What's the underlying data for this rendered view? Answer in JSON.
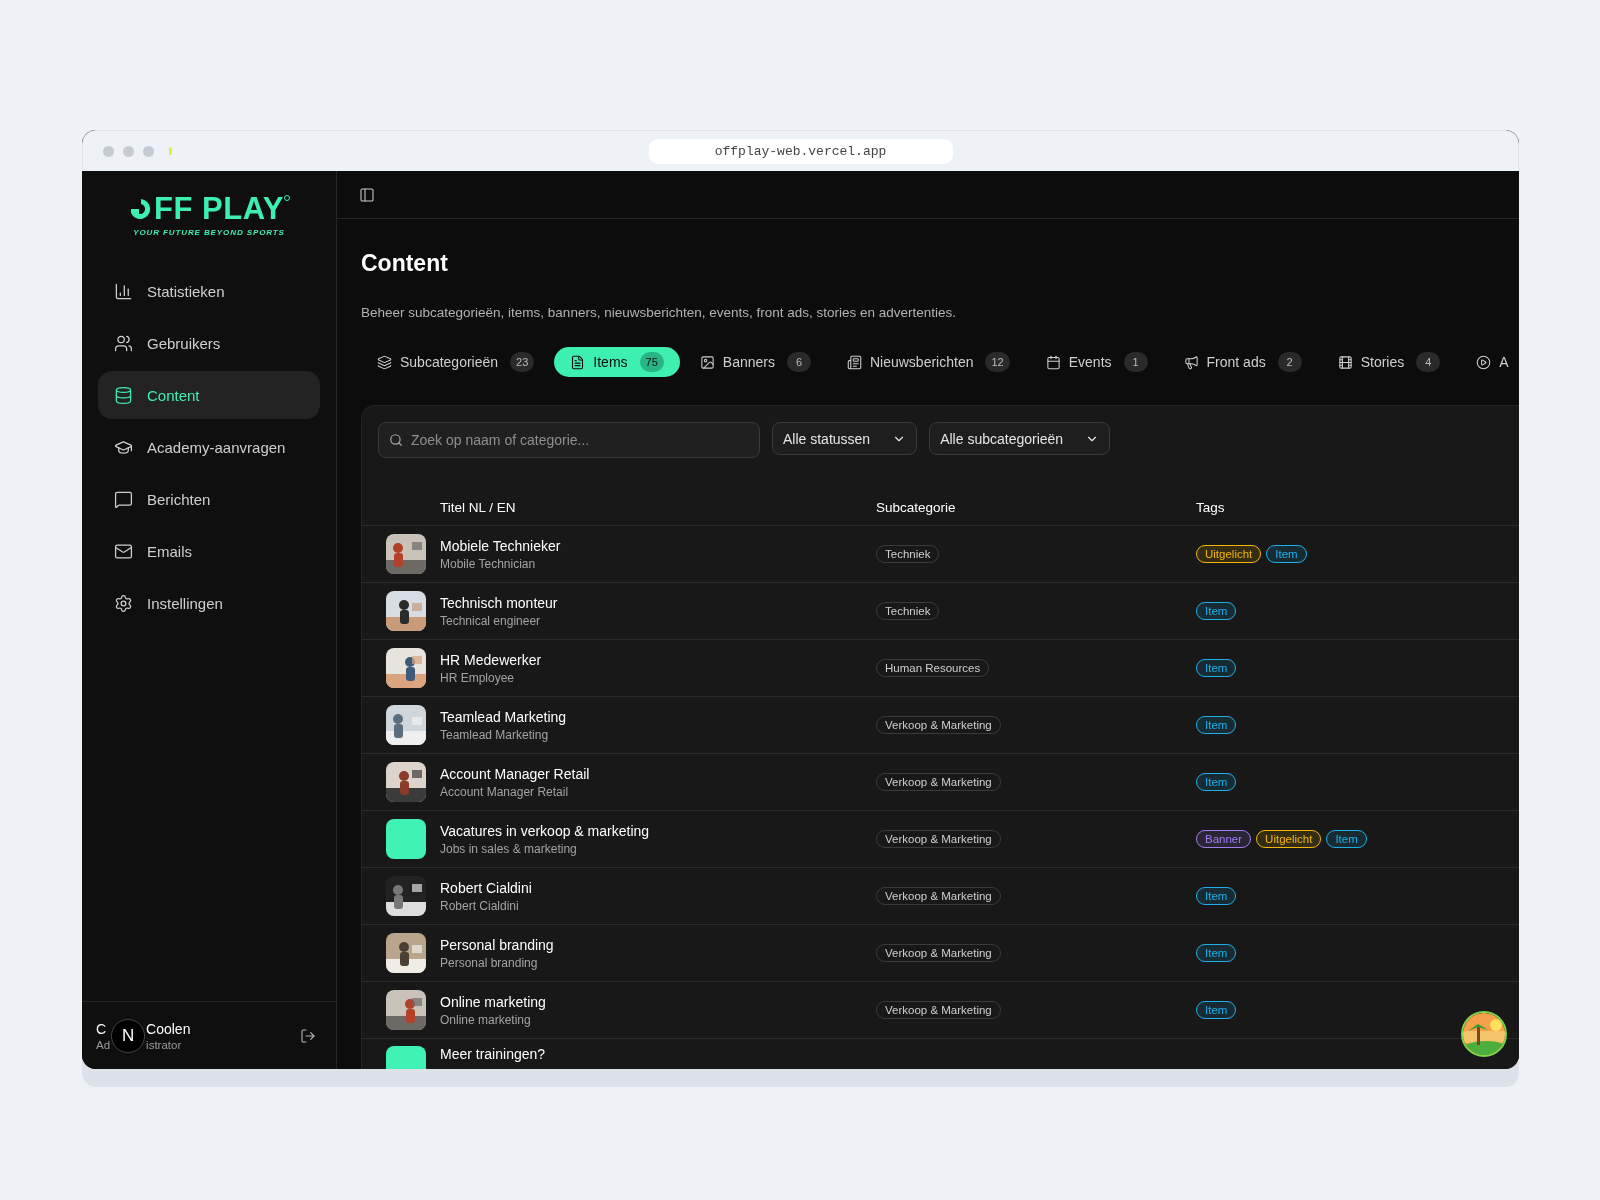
{
  "browser": {
    "url": "offplay-web.vercel.app"
  },
  "sidebar": {
    "logo": {
      "text": "FF PLAY",
      "tagline": "YOUR FUTURE BEYOND SPORTS"
    },
    "items": [
      {
        "label": "Statistieken",
        "selected": false
      },
      {
        "label": "Gebruikers",
        "selected": false
      },
      {
        "label": "Content",
        "selected": true
      },
      {
        "label": "Academy-aanvragen",
        "selected": false
      },
      {
        "label": "Berichten",
        "selected": false
      },
      {
        "label": "Emails",
        "selected": false
      },
      {
        "label": "Instellingen",
        "selected": false
      }
    ],
    "user": {
      "name_start": "C",
      "name_end": "Coolen",
      "role_start": "Ad",
      "role_end": "istrator",
      "badge": "N"
    }
  },
  "page": {
    "title": "Content",
    "description": "Beheer subcategorieën, items, banners, nieuwsberichten, events, front ads, stories en advertenties."
  },
  "tabs": [
    {
      "label": "Subcategorieën",
      "count": "23",
      "selected": false
    },
    {
      "label": "Items",
      "count": "75",
      "selected": true
    },
    {
      "label": "Banners",
      "count": "6",
      "selected": false
    },
    {
      "label": "Nieuwsberichten",
      "count": "12",
      "selected": false
    },
    {
      "label": "Events",
      "count": "1",
      "selected": false
    },
    {
      "label": "Front ads",
      "count": "2",
      "selected": false
    },
    {
      "label": "Stories",
      "count": "4",
      "selected": false
    },
    {
      "label": "A",
      "selected": false
    }
  ],
  "filters": {
    "search": {
      "placeholder": "Zoek op naam of categorie..."
    },
    "selects": [
      "Alle statussen",
      "Alle subcategorieën"
    ]
  },
  "table": {
    "columns": [
      "Titel NL / EN",
      "Subcategorie",
      "Tags"
    ],
    "rows": [
      {
        "title": "Mobiele Technieker",
        "subtitle": "Mobile Technician",
        "thumb": {
          "kind": "picture"
        },
        "subcategory": "Techniek",
        "tags": [
          {
            "label": "Uitgelicht",
            "color": "#f2b705"
          },
          {
            "label": "Item",
            "color": "#1cb0ea"
          }
        ]
      },
      {
        "title": "Technisch monteur",
        "subtitle": "Technical engineer",
        "thumb": {
          "kind": "picture"
        },
        "subcategory": "Techniek",
        "tags": [
          {
            "label": "Item",
            "color": "#1cb0ea"
          }
        ]
      },
      {
        "title": "HR Medewerker",
        "subtitle": "HR Employee",
        "thumb": {
          "kind": "picture"
        },
        "subcategory": "Human Resources",
        "tags": [
          {
            "label": "Item",
            "color": "#1cb0ea"
          }
        ]
      },
      {
        "title": "Teamlead Marketing",
        "subtitle": "Teamlead Marketing",
        "thumb": {
          "kind": "picture"
        },
        "subcategory": "Verkoop & Marketing",
        "tags": [
          {
            "label": "Item",
            "color": "#1cb0ea"
          }
        ]
      },
      {
        "title": "Account Manager Retail",
        "subtitle": "Account Manager Retail",
        "thumb": {
          "kind": "picture"
        },
        "subcategory": "Verkoop & Marketing",
        "tags": [
          {
            "label": "Item",
            "color": "#1cb0ea"
          }
        ]
      },
      {
        "title": "Vacatures in verkoop & marketing",
        "subtitle": "Jobs in sales & marketing",
        "thumb": {
          "kind": "swatch",
          "color": "#40f2b4"
        },
        "subcategory": "Verkoop & Marketing",
        "tags": [
          {
            "label": "Banner",
            "color": "#a27cf2"
          },
          {
            "label": "Uitgelicht",
            "color": "#f2b705"
          },
          {
            "label": "Item",
            "color": "#1cb0ea"
          }
        ]
      },
      {
        "title": "Robert Cialdini",
        "subtitle": "Robert Cialdini",
        "thumb": {
          "kind": "picture"
        },
        "subcategory": "Verkoop & Marketing",
        "tags": [
          {
            "label": "Item",
            "color": "#1cb0ea"
          }
        ]
      },
      {
        "title": "Personal branding",
        "subtitle": "Personal branding",
        "thumb": {
          "kind": "picture"
        },
        "subcategory": "Verkoop & Marketing",
        "tags": [
          {
            "label": "Item",
            "color": "#1cb0ea"
          }
        ]
      },
      {
        "title": "Online marketing",
        "subtitle": "Online marketing",
        "thumb": {
          "kind": "picture"
        },
        "subcategory": "Verkoop & Marketing",
        "tags": [
          {
            "label": "Item",
            "color": "#1cb0ea"
          }
        ]
      },
      {
        "title": "Meer trainingen?",
        "thumb": {
          "kind": "swatch",
          "color": "#40f2b4"
        }
      }
    ]
  }
}
